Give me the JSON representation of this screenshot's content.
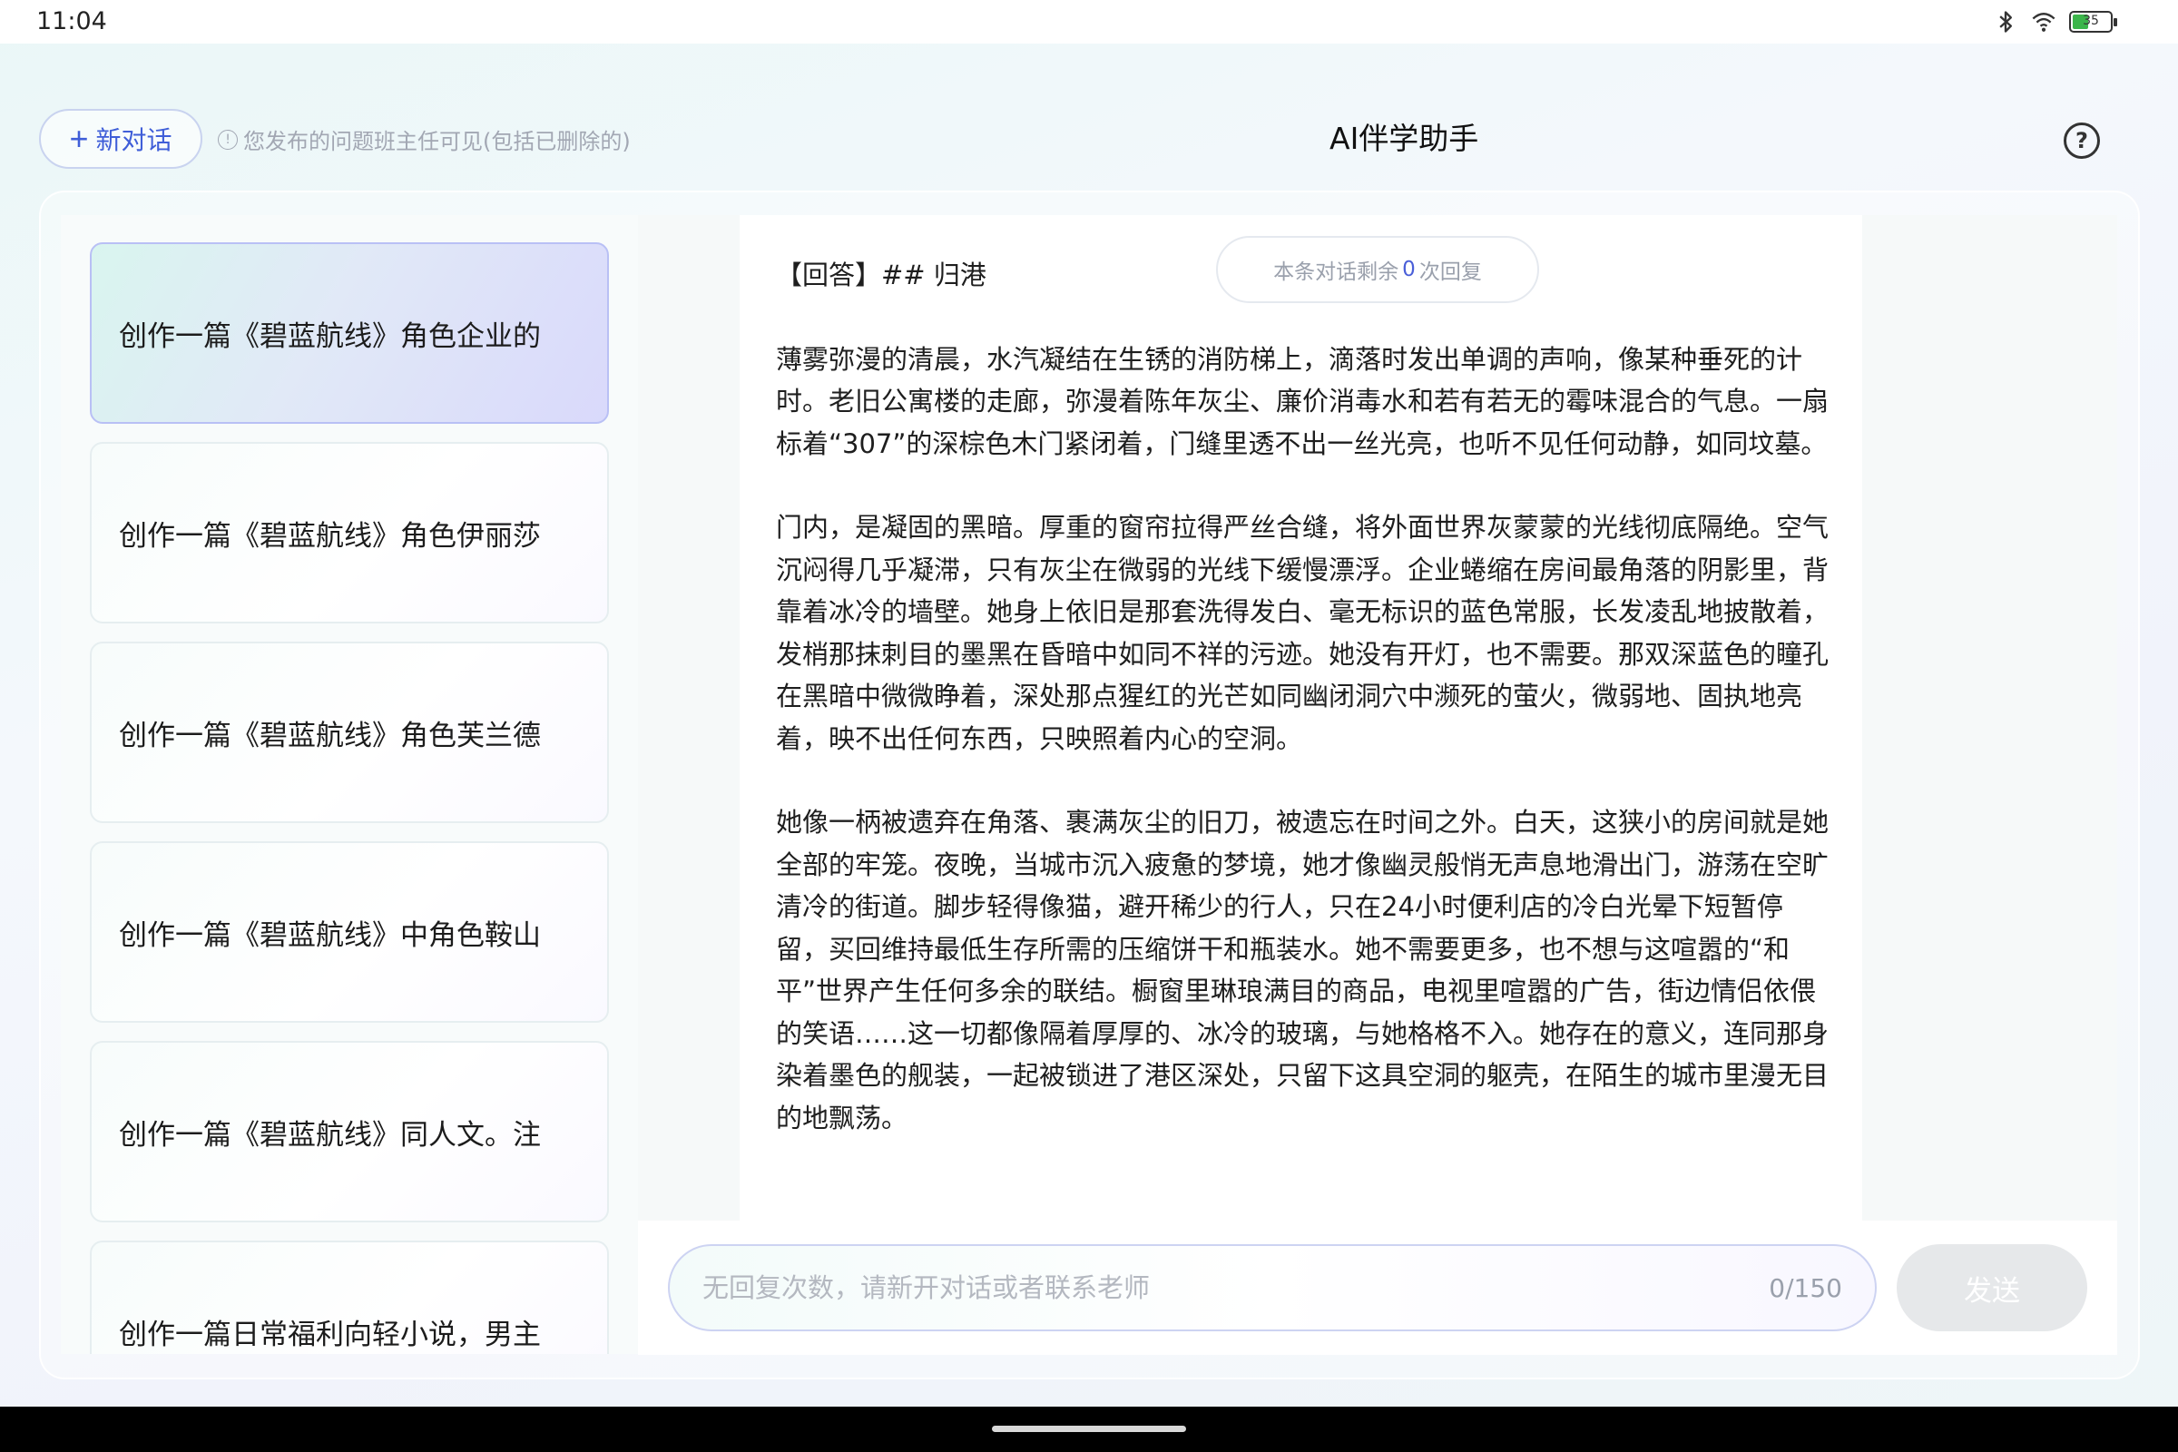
{
  "status_bar": {
    "time": "11:04",
    "battery_level": "35",
    "icons": [
      "bluetooth-icon",
      "wifi-icon",
      "battery-icon"
    ]
  },
  "header": {
    "new_chat_label": "新对话",
    "notice": "您发布的问题班主任可见(包括已删除的)",
    "title": "AI伴学助手"
  },
  "sidebar": {
    "items": [
      {
        "label": "创作一篇《碧蓝航线》角色企业的",
        "active": true
      },
      {
        "label": "创作一篇《碧蓝航线》角色伊丽莎",
        "active": false
      },
      {
        "label": "创作一篇《碧蓝航线》角色芙兰德",
        "active": false
      },
      {
        "label": "创作一篇《碧蓝航线》中角色鞍山",
        "active": false
      },
      {
        "label": "创作一篇《碧蓝航线》同人文。注",
        "active": false
      },
      {
        "label": "创作一篇日常福利向轻小说，男主",
        "active": false
      }
    ]
  },
  "chat": {
    "remaining_prefix": "本条对话剩余",
    "remaining_count": "0",
    "remaining_suffix": "次回复",
    "answer_heading": "【回答】## 归港",
    "paragraphs": [
      "薄雾弥漫的清晨，水汽凝结在生锈的消防梯上，滴落时发出单调的声响，像某种垂死的计时。老旧公寓楼的走廊，弥漫着陈年灰尘、廉价消毒水和若有若无的霉味混合的气息。一扇标着“307”的深棕色木门紧闭着，门缝里透不出一丝光亮，也听不见任何动静，如同坟墓。",
      "门内，是凝固的黑暗。厚重的窗帘拉得严丝合缝，将外面世界灰蒙蒙的光线彻底隔绝。空气沉闷得几乎凝滞，只有灰尘在微弱的光线下缓慢漂浮。企业蜷缩在房间最角落的阴影里，背靠着冰冷的墙壁。她身上依旧是那套洗得发白、毫无标识的蓝色常服，长发凌乱地披散着，发梢那抹刺目的墨黑在昏暗中如同不祥的污迹。她没有开灯，也不需要。那双深蓝色的瞳孔在黑暗中微微睁着，深处那点猩红的光芒如同幽闭洞穴中濒死的萤火，微弱地、固执地亮着，映不出任何东西，只映照着内心的空洞。",
      "她像一柄被遗弃在角落、裹满灰尘的旧刀，被遗忘在时间之外。白天，这狭小的房间就是她全部的牢笼。夜晚，当城市沉入疲惫的梦境，她才像幽灵般悄无声息地滑出门，游荡在空旷清冷的街道。脚步轻得像猫，避开稀少的行人，只在24小时便利店的冷白光晕下短暂停留，买回维持最低生存所需的压缩饼干和瓶装水。她不需要更多，也不想与这喧嚣的“和平”世界产生任何多余的联结。橱窗里琳琅满目的商品，电视里喧嚣的广告，街边情侣依偎的笑语……这一切都像隔着厚厚的、冰冷的玻璃，与她格格不入。她存在的意义，连同那身染着墨色的舰装，一起被锁进了港区深处，只留下这具空洞的躯壳，在陌生的城市里漫无目的地飘荡。"
    ]
  },
  "input": {
    "placeholder": "无回复次数，请新开对话或者联系老师",
    "value": "",
    "char_count": "0/150",
    "send_label": "发送"
  },
  "colors": {
    "accent": "#3f5ed8",
    "active_card_start": "#d9f5ef",
    "active_card_end": "#d9d9fb",
    "send_disabled": "#e6e8ea"
  }
}
